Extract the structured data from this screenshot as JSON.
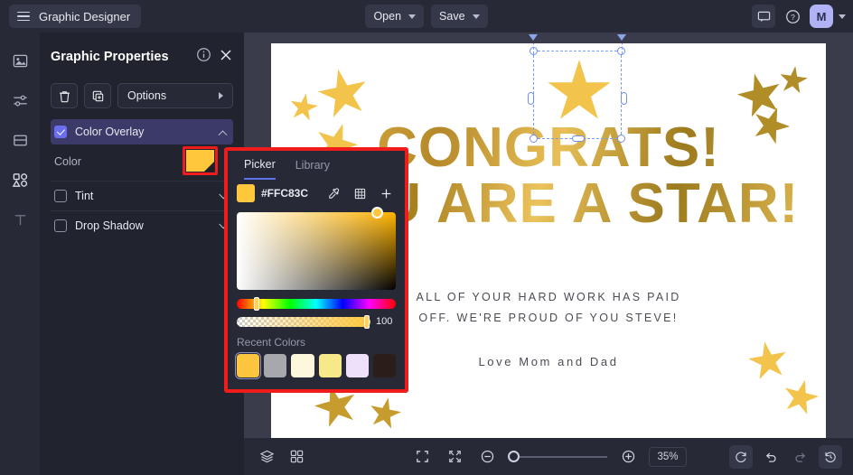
{
  "topbar": {
    "app_title": "Graphic Designer",
    "menu_icon": "hamburger-icon",
    "open_label": "Open",
    "save_label": "Save",
    "comment_icon": "comment-icon",
    "help_icon": "help-icon",
    "avatar_initial": "M"
  },
  "rail": {
    "items": [
      {
        "name": "image-tool",
        "icon": "image-icon"
      },
      {
        "name": "adjustments-tool",
        "icon": "sliders-icon"
      },
      {
        "name": "layout-tool",
        "icon": "panel-icon"
      },
      {
        "name": "shapes-tool",
        "icon": "shapes-icon"
      },
      {
        "name": "text-tool",
        "icon": "text-icon"
      }
    ]
  },
  "panel": {
    "title": "Graphic Properties",
    "info_icon": "info-icon",
    "close_icon": "close-icon",
    "delete_icon": "trash-icon",
    "duplicate_icon": "duplicate-icon",
    "options_label": "Options",
    "sections": [
      {
        "label": "Color Overlay",
        "checked": true,
        "expanded": true
      },
      {
        "label": "Tint",
        "checked": false,
        "expanded": false
      },
      {
        "label": "Drop Shadow",
        "checked": false,
        "expanded": false
      }
    ],
    "color_label": "Color",
    "color_value": "#FFC83C"
  },
  "color_picker": {
    "tabs": [
      {
        "label": "Picker",
        "active": true
      },
      {
        "label": "Library",
        "active": false
      }
    ],
    "hex_value": "#FFC83C",
    "eyedropper_icon": "eyedropper-icon",
    "palette_icon": "grid-palette-icon",
    "add_icon": "plus-icon",
    "alpha_value": "100",
    "recent_label": "Recent Colors",
    "recent_colors": [
      "#FCC53F",
      "#A6A8AD",
      "#FDF8DC",
      "#F7E98A",
      "#EEDFFB",
      "#2B1E18"
    ]
  },
  "canvas": {
    "headline_1": "CONGRATS!",
    "headline_2": "YOU ARE A STAR!",
    "body_line_1": "ALL OF YOUR HARD WORK HAS PAID",
    "body_line_2": "OFF. WE'RE PROUD OF YOU STEVE!",
    "signature": "Love Mom and Dad",
    "star_color_light": "#F2C44B",
    "star_color_dark": "#B08D27"
  },
  "bottombar": {
    "layers_icon": "layers-icon",
    "grid_icon": "grid-icon",
    "fit_screen_icon": "fit-screen-icon",
    "fit_selection_icon": "fit-selection-icon",
    "zoom_out_icon": "zoom-out-icon",
    "zoom_in_icon": "zoom-in-icon",
    "zoom_level": "35%",
    "reset_icon": "reset-icon",
    "undo_icon": "undo-icon",
    "redo_icon": "redo-icon",
    "history_icon": "history-icon"
  }
}
